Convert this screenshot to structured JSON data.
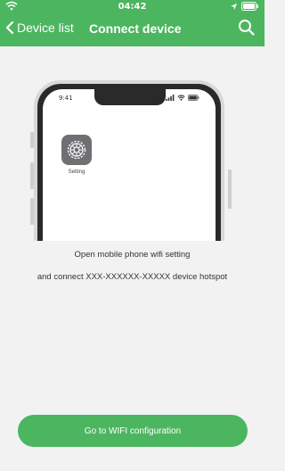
{
  "status_bar": {
    "time": "04:42"
  },
  "header": {
    "back_label": "Device list",
    "title": "Connect device"
  },
  "illustration": {
    "phone_time": "9:41",
    "app_label": "Setting"
  },
  "instructions": {
    "line1": "Open mobile phone wifi setting",
    "line2": "and connect XXX-XXXXXX-XXXXX device hotspot"
  },
  "cta": {
    "label": "Go to WIFI configuration"
  },
  "colors": {
    "brand": "#4cb560",
    "background": "#f2f2f2"
  },
  "icons": [
    "wifi-icon",
    "location-arrow-icon",
    "battery-icon",
    "chevron-left-icon",
    "search-icon",
    "gear-icon",
    "signal-icon"
  ]
}
